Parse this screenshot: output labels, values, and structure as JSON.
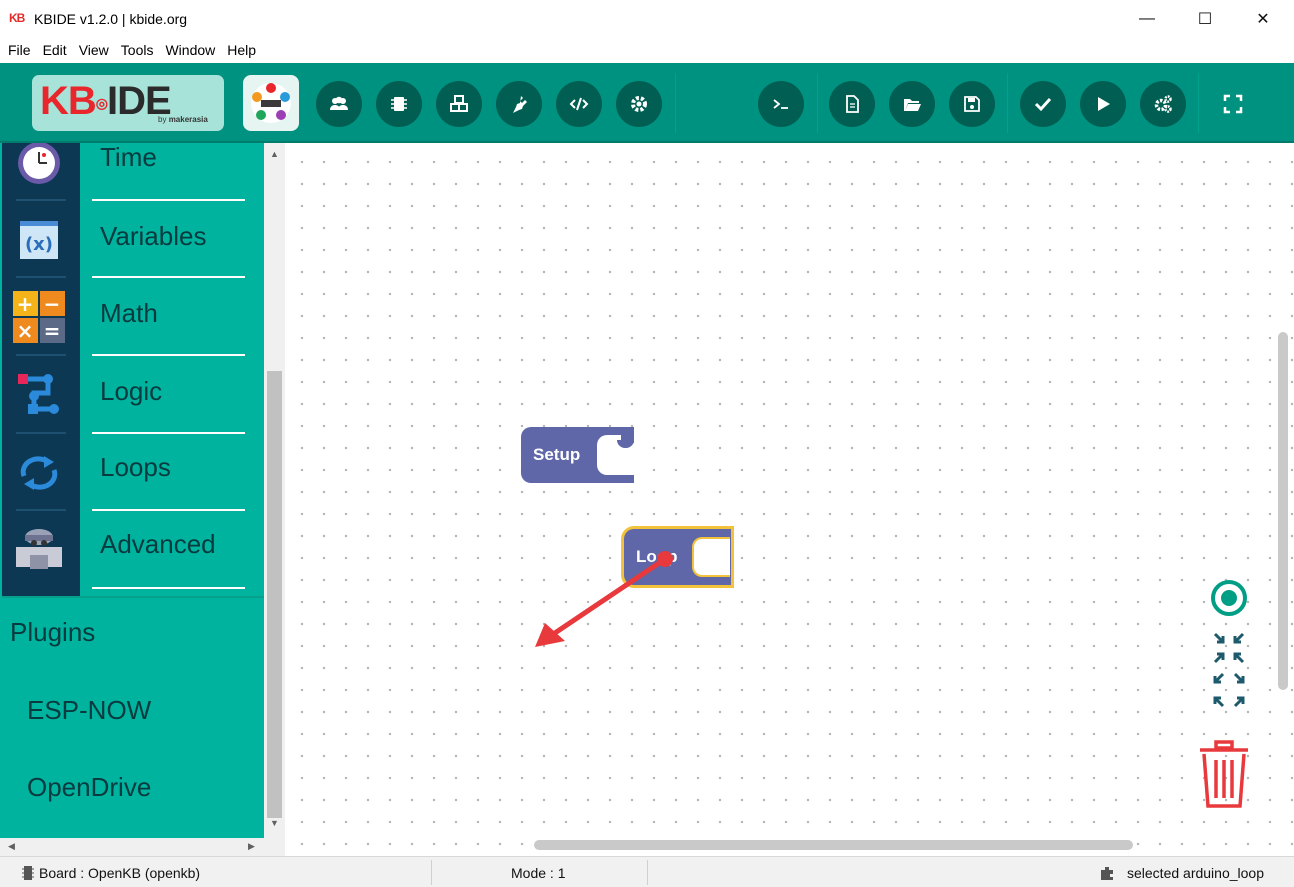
{
  "window": {
    "logo_text": "KB",
    "title": "KBIDE v1.2.0 | kbide.org",
    "minimize_glyph": "—",
    "maximize_glyph": "☐",
    "close_glyph": "✕"
  },
  "menu": [
    "File",
    "Edit",
    "View",
    "Tools",
    "Window",
    "Help"
  ],
  "toolbar": {
    "logo_kb": "KB",
    "logo_ide": "IDE",
    "logo_by": "by",
    "logo_maker": "makerasia",
    "left_buttons": [
      "users-icon",
      "chip-icon",
      "cubes-icon",
      "plug-icon",
      "code-icon",
      "gear-icon"
    ],
    "right_buttons": [
      "terminal-icon",
      "new-file-icon",
      "open-folder-icon",
      "save-icon",
      "check-icon",
      "play-icon",
      "cogs-icon",
      "fullscreen-icon"
    ],
    "accent": "#009280",
    "button_color": "#005e52"
  },
  "sidebar": {
    "categories": [
      {
        "label": "Time",
        "icon": "clock-icon"
      },
      {
        "label": "Variables",
        "icon": "variable-icon"
      },
      {
        "label": "Math",
        "icon": "math-icon"
      },
      {
        "label": "Logic",
        "icon": "logic-icon"
      },
      {
        "label": "Loops",
        "icon": "loop-icon"
      },
      {
        "label": "Advanced",
        "icon": "advanced-icon"
      }
    ],
    "plugins_heading": "Plugins",
    "plugins": [
      "ESP-NOW",
      "OpenDrive"
    ]
  },
  "workspace": {
    "blocks": [
      {
        "label": "Setup",
        "color": "#5f67a8"
      },
      {
        "label": "Loop",
        "color": "#5f67a8",
        "selected": true,
        "highlight": "#f2c33a"
      }
    ],
    "annotation_arrow_color": "#e8393c",
    "controls": [
      "recenter-icon",
      "zoom-to-fit-icon",
      "trash-icon"
    ]
  },
  "status": {
    "board": "Board : OpenKB (openkb)",
    "mode": "Mode : 1",
    "selected": "selected arduino_loop"
  }
}
